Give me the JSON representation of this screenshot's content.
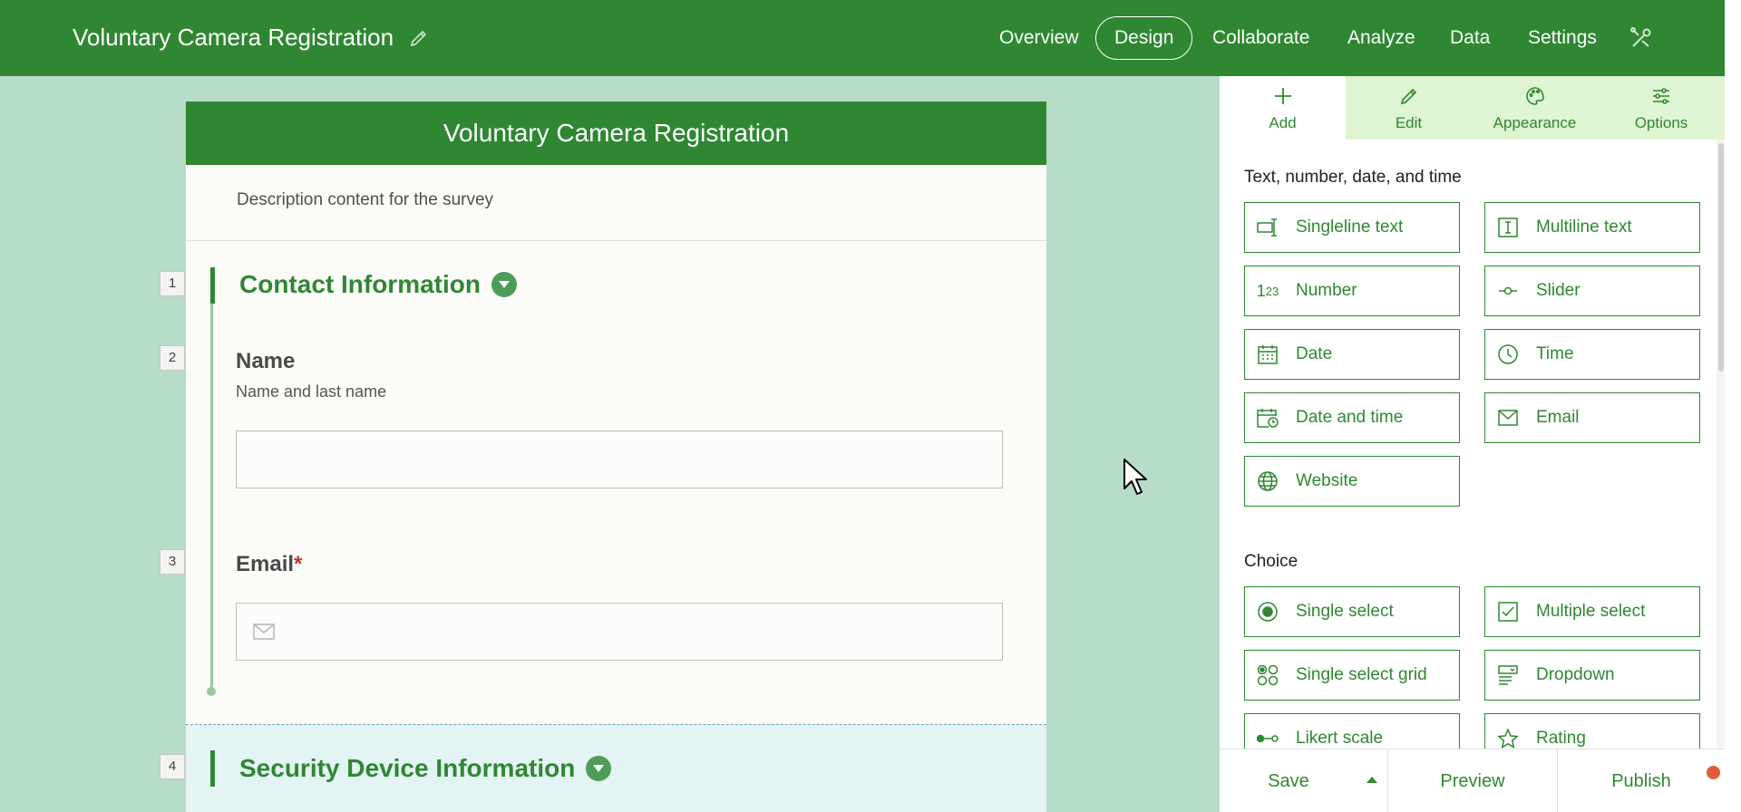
{
  "app": {
    "title": "Voluntary Camera Registration",
    "nav": [
      "Overview",
      "Design",
      "Collaborate",
      "Analyze",
      "Data",
      "Settings"
    ],
    "active_nav": "Design"
  },
  "form": {
    "header": "Voluntary Camera Registration",
    "description": "Description content for the survey",
    "section1": {
      "number": "1",
      "title": "Contact Information"
    },
    "q_name": {
      "number": "2",
      "label": "Name",
      "hint": "Name and last name"
    },
    "q_email": {
      "number": "3",
      "label": "Email",
      "required_mark": "*"
    },
    "section2": {
      "number": "4",
      "title": "Security Device Information"
    }
  },
  "panel": {
    "tabs": [
      {
        "label": "Add",
        "icon": "plus-icon"
      },
      {
        "label": "Edit",
        "icon": "pencil-icon"
      },
      {
        "label": "Appearance",
        "icon": "palette-icon"
      },
      {
        "label": "Options",
        "icon": "sliders-icon"
      }
    ],
    "cat_text": "Text, number, date, and time",
    "cat_choice": "Choice",
    "fields_text": [
      {
        "label": "Singleline text",
        "icon": "singleline-icon"
      },
      {
        "label": "Multiline text",
        "icon": "multiline-icon"
      },
      {
        "label": "Number",
        "icon": "number-icon"
      },
      {
        "label": "Slider",
        "icon": "slider-icon"
      },
      {
        "label": "Date",
        "icon": "calendar-icon"
      },
      {
        "label": "Time",
        "icon": "clock-icon"
      },
      {
        "label": "Date and time",
        "icon": "calendar-clock-icon"
      },
      {
        "label": "Email",
        "icon": "envelope-icon"
      },
      {
        "label": "Website",
        "icon": "globe-icon"
      }
    ],
    "fields_choice": [
      {
        "label": "Single select",
        "icon": "radio-icon"
      },
      {
        "label": "Multiple select",
        "icon": "checkbox-icon"
      },
      {
        "label": "Single select grid",
        "icon": "grid-icon"
      },
      {
        "label": "Dropdown",
        "icon": "dropdown-icon"
      },
      {
        "label": "Likert scale",
        "icon": "likert-icon"
      },
      {
        "label": "Rating",
        "icon": "star-icon"
      }
    ],
    "bottom": {
      "save": "Save",
      "preview": "Preview",
      "publish": "Publish"
    }
  },
  "colors": {
    "brand": "#2f8732",
    "canvas": "#b7dcc8",
    "tab_bg": "#dff4d2",
    "badge": "#e05a3e"
  }
}
